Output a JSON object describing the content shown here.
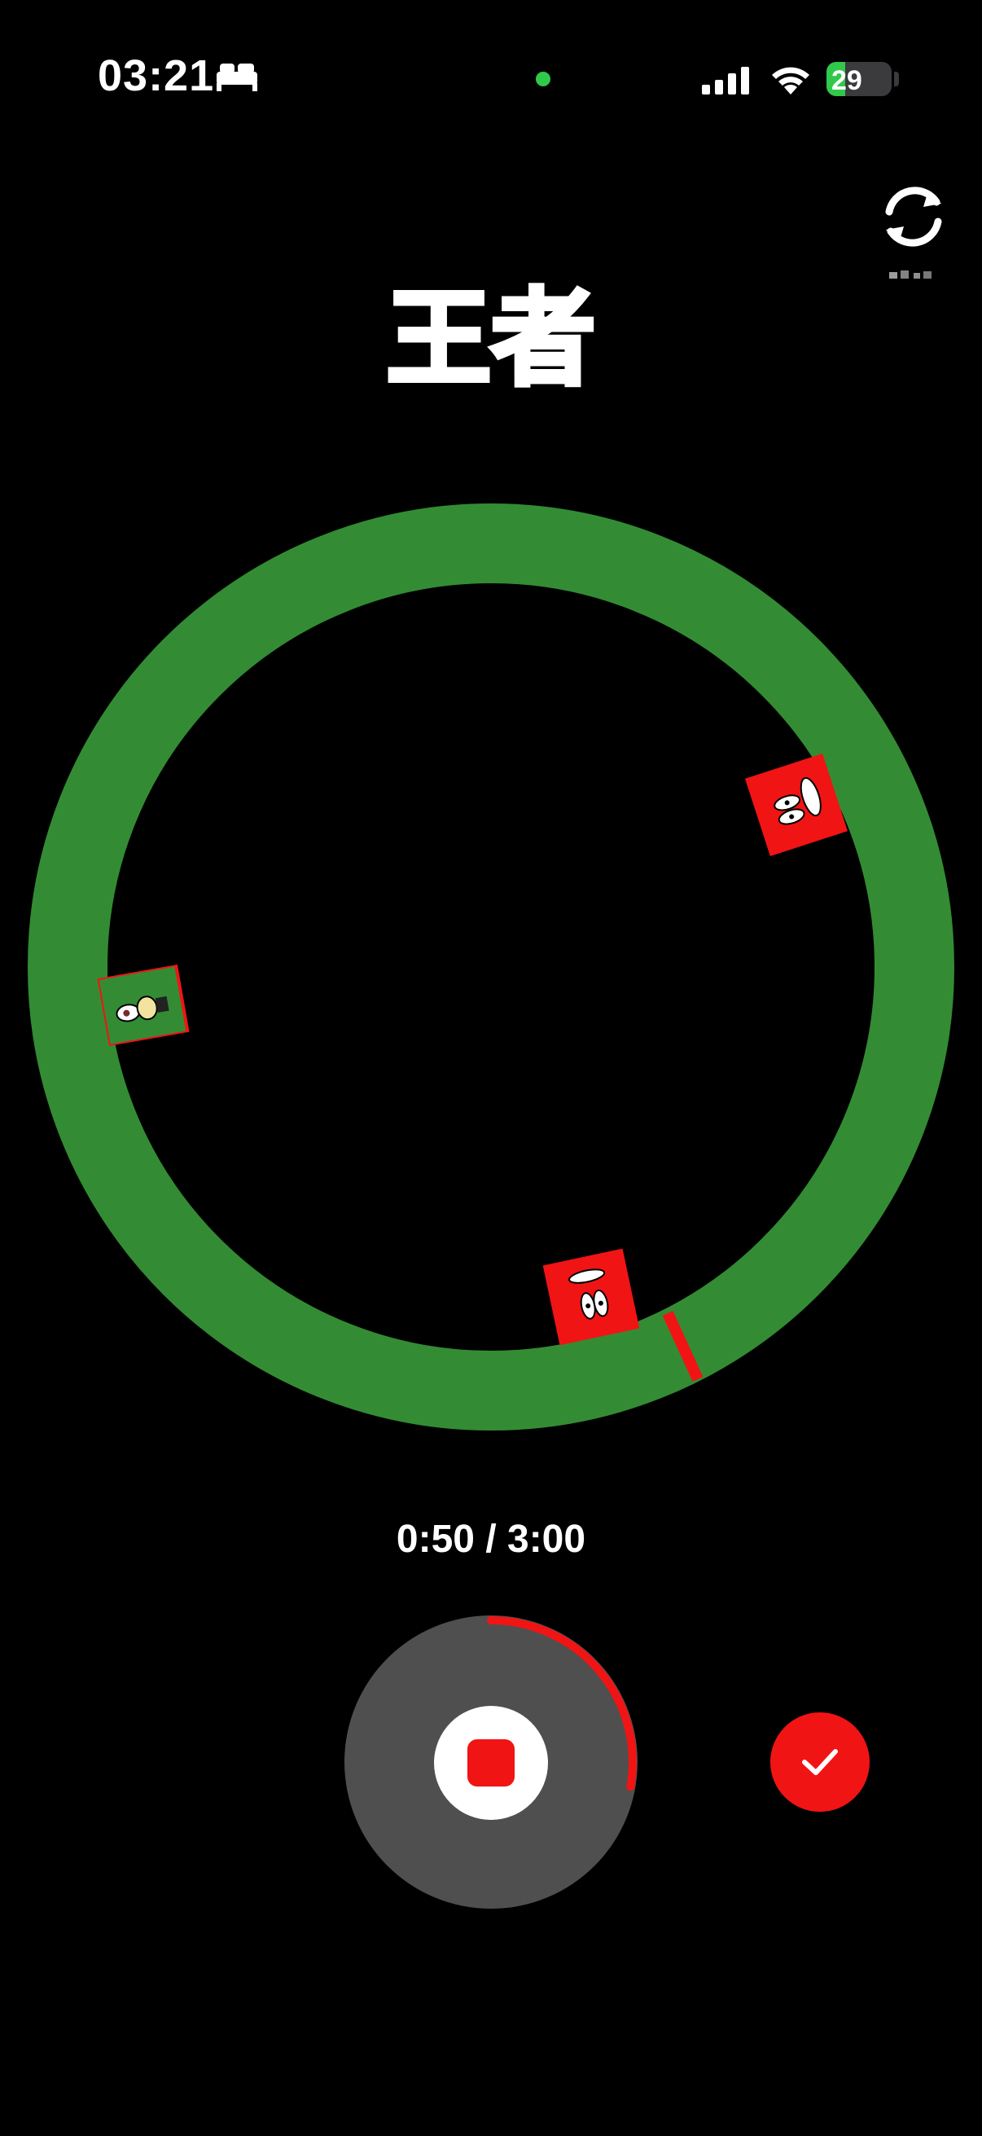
{
  "status_bar": {
    "time": "03:21",
    "battery_percent": "29",
    "battery_level": 0.29,
    "icons": [
      "sleep-icon",
      "signal-icon",
      "wifi-icon",
      "battery-charging-icon"
    ]
  },
  "title": "王者",
  "recording": {
    "timer": "0:50 / 3:00",
    "elapsed_fraction": 0.2778
  },
  "colors": {
    "ring_green": "#338c33",
    "accent_red": "#f11414",
    "control_gray": "#4f4f4f"
  },
  "icons": {
    "flip_camera": "flip-camera-icon",
    "stop": "stop-icon",
    "confirm": "checkmark-icon"
  }
}
